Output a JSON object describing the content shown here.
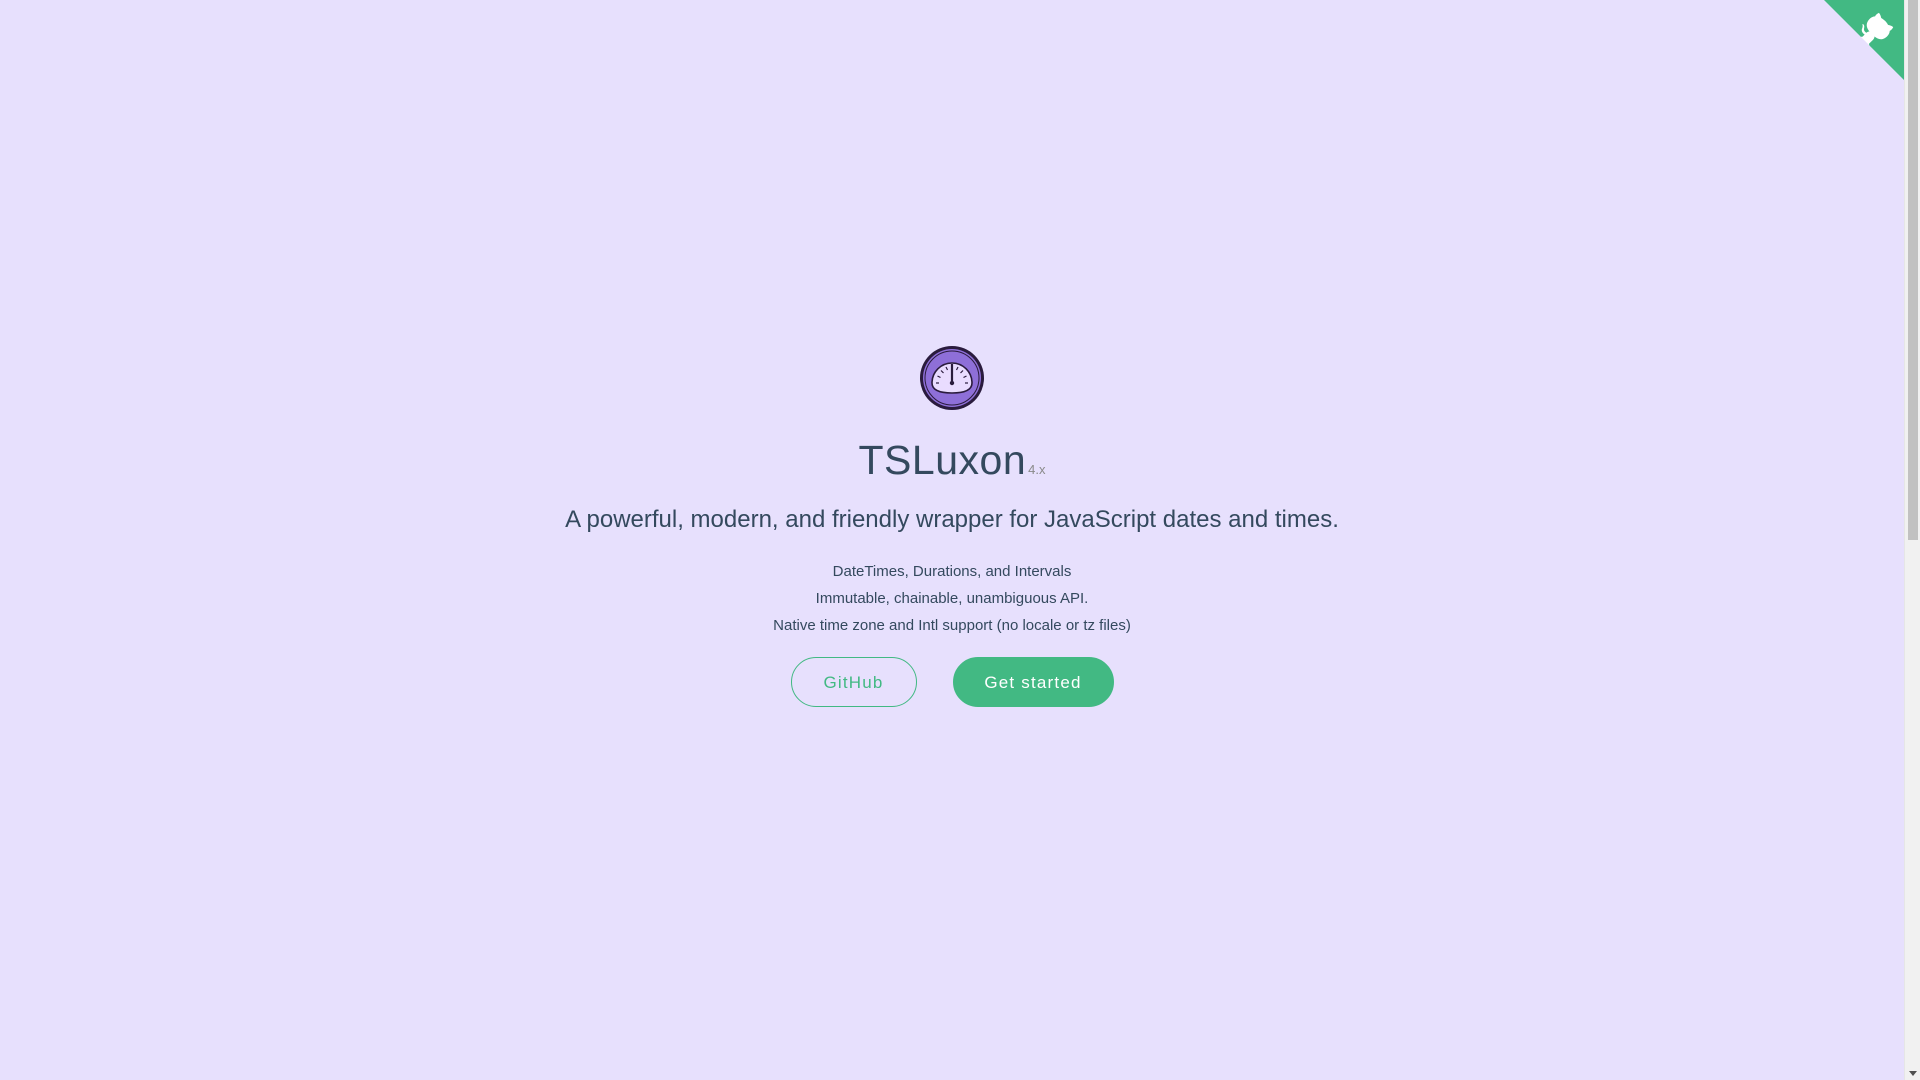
{
  "cover": {
    "title": "TSLuxon",
    "version": "4.x",
    "tagline": "A powerful, modern, and friendly wrapper for JavaScript dates and times.",
    "features": [
      "DateTimes, Durations, and Intervals",
      "Immutable, chainable, unambiguous API.",
      "Native time zone and Intl support (no locale or tz files)"
    ],
    "buttons": {
      "github": "GitHub",
      "get_started": "Get started"
    },
    "logo_icon": "clock-dial-icon"
  },
  "corner": {
    "icon": "github-octocat-icon"
  },
  "colors": {
    "background": "#e7e0fd",
    "accent": "#42b983",
    "text": "#34495e"
  }
}
